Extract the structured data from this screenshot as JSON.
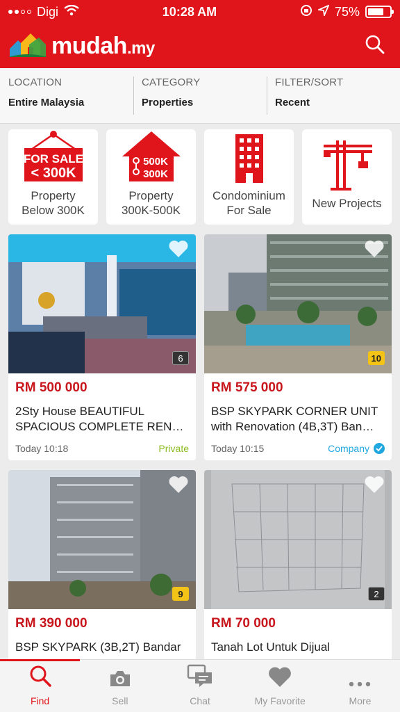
{
  "status": {
    "carrier": "Digi",
    "time": "10:28 AM",
    "battery_text": "75%",
    "battery_level": 0.75
  },
  "app": {
    "brand_name": "mudah",
    "brand_tld": ".my"
  },
  "filters": [
    {
      "label": "LOCATION",
      "value": "Entire Malaysia"
    },
    {
      "label": "CATEGORY",
      "value": "Properties"
    },
    {
      "label": "FILTER/SORT",
      "value": "Recent"
    }
  ],
  "categories": [
    {
      "line1": "Property",
      "line2": "Below 300K",
      "icon": "for-sale-sign-icon",
      "sign_line1": "FOR SALE",
      "sign_line2": "< 300K"
    },
    {
      "line1": "Property",
      "line2": "300K-500K",
      "icon": "house-price-icon",
      "sign_line1": "500K",
      "sign_line2": "300K"
    },
    {
      "line1": "Condominium",
      "line2": "For Sale",
      "icon": "building-icon"
    },
    {
      "line1": "New Projects",
      "line2": "",
      "icon": "crane-icon"
    }
  ],
  "listings": [
    {
      "price": "RM 500 000",
      "title": "2Sty House BEAUTIFUL SPACIOUS COMPLETE REN…",
      "time": "Today 10:18",
      "seller": "Private",
      "seller_type": "private",
      "photo_count": "6",
      "badge_style": "dark"
    },
    {
      "price": "RM 575 000",
      "title": "BSP SKYPARK CORNER UNIT with Renovation (4B,3T) Ban…",
      "time": "Today 10:15",
      "seller": "Company",
      "seller_type": "company",
      "photo_count": "10",
      "badge_style": "yellow"
    },
    {
      "price": "RM 390 000",
      "title": "BSP SKYPARK (3B,2T) Bandar",
      "time": "",
      "seller": "",
      "seller_type": "",
      "photo_count": "9",
      "badge_style": "yellow"
    },
    {
      "price": "RM 70 000",
      "title": "Tanah Lot Untuk Dijual",
      "time": "",
      "seller": "",
      "seller_type": "",
      "photo_count": "2",
      "badge_style": "dark"
    }
  ],
  "tabs": [
    {
      "label": "Find",
      "icon": "search-icon",
      "active": true
    },
    {
      "label": "Sell",
      "icon": "camera-icon",
      "active": false
    },
    {
      "label": "Chat",
      "icon": "chat-icon",
      "active": false
    },
    {
      "label": "My Favorite",
      "icon": "heart-icon",
      "active": false
    },
    {
      "label": "More",
      "icon": "more-icon",
      "active": false
    }
  ],
  "colors": {
    "brand_red": "#e0151b",
    "price_red": "#c8161d",
    "private_green": "#8cbc22",
    "company_blue": "#21a7e0"
  }
}
